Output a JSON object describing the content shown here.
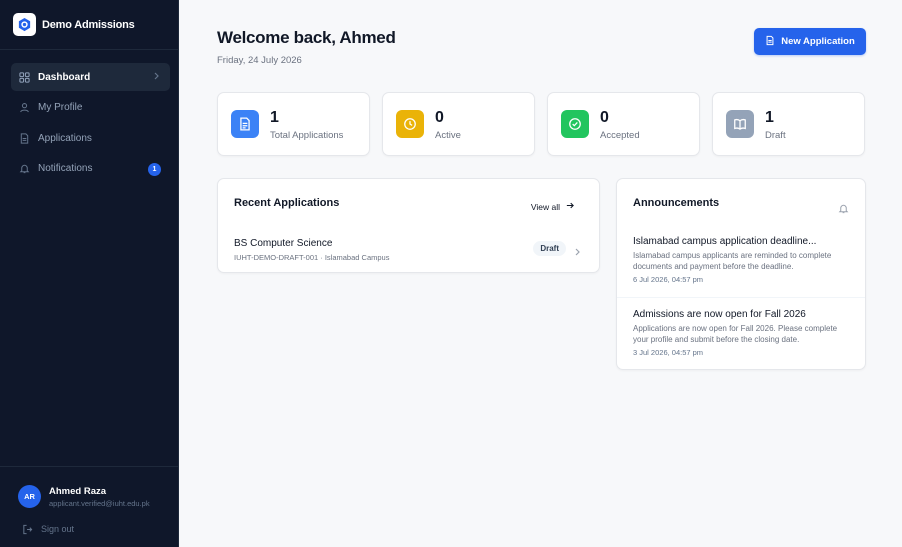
{
  "app": {
    "name": "Demo Admissions"
  },
  "colors": {
    "accent": "#2563eb",
    "sidebar_bg": "#0f172a",
    "active_stat": "#eab308",
    "accepted_stat": "#22c55e",
    "draft_stat": "#94a3b8"
  },
  "sidebar": {
    "items": [
      {
        "label": "Dashboard",
        "icon": "grid-icon",
        "active": true
      },
      {
        "label": "My Profile",
        "icon": "user-icon"
      },
      {
        "label": "Applications",
        "icon": "document-icon"
      },
      {
        "label": "Notifications",
        "icon": "bell-icon",
        "badge": "1"
      }
    ],
    "user": {
      "initials": "AR",
      "name": "Ahmed Raza",
      "email": "applicant.verified@iuht.edu.pk"
    },
    "sign_out": "Sign out"
  },
  "header": {
    "title": "Welcome back, Ahmed",
    "date": "Friday, 24 July 2026",
    "new_button": "New Application"
  },
  "stats": [
    {
      "value": "1",
      "label": "Total Applications",
      "icon": "document-icon"
    },
    {
      "value": "0",
      "label": "Active",
      "icon": "clock-icon"
    },
    {
      "value": "0",
      "label": "Accepted",
      "icon": "check-circle-icon"
    },
    {
      "value": "1",
      "label": "Draft",
      "icon": "book-icon"
    }
  ],
  "recent": {
    "title": "Recent Applications",
    "view_all": "View all",
    "items": [
      {
        "program": "BS Computer Science",
        "meta": "IUHT-DEMO-DRAFT-001 · Islamabad Campus",
        "status": "Draft"
      }
    ]
  },
  "announcements": {
    "title": "Announcements",
    "items": [
      {
        "title": "Islamabad campus application deadline...",
        "body": "Islamabad campus applicants are reminded to complete documents and payment before the deadline.",
        "date": "6 Jul 2026, 04:57 pm"
      },
      {
        "title": "Admissions are now open for Fall 2026",
        "body": "Applications are now open for Fall 2026. Please complete your profile and submit before the closing date.",
        "date": "3 Jul 2026, 04:57 pm"
      }
    ]
  }
}
